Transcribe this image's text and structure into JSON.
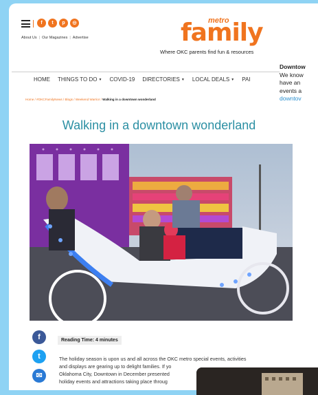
{
  "header": {
    "top_links": [
      "About Us",
      "Our Magazines",
      "Advertise"
    ],
    "social_icons": [
      "facebook-icon",
      "twitter-icon",
      "pinterest-icon",
      "instagram-icon"
    ],
    "logo": {
      "metro": "metro",
      "family": "family"
    },
    "tagline": "Where OKC parents find fun & resources"
  },
  "promo": {
    "title": "Downtow",
    "lines": [
      "We know",
      "have an",
      "events a"
    ],
    "link": "downtov"
  },
  "nav": {
    "items": [
      {
        "label": "HOME",
        "caret": false
      },
      {
        "label": "THINGS TO DO",
        "caret": true
      },
      {
        "label": "COVID-19",
        "caret": false
      },
      {
        "label": "DIRECTORIES",
        "caret": true
      },
      {
        "label": "LOCAL DEALS",
        "caret": true
      },
      {
        "label": "PAI",
        "caret": false
      }
    ]
  },
  "breadcrumb": {
    "items": [
      "Home",
      "#OKCFamilyNews",
      "Blogs",
      "Weekend Warrior"
    ],
    "current": "Walking in a downtown wonderland",
    "separator": " / "
  },
  "article": {
    "title": "Walking in a downtown wonderland",
    "reading_time": "Reading Time: 4 minutes",
    "body": [
      "The holiday season is upon us and all across the OKC metro special events, activities",
      "and displays are gearing up to delight families. If yo",
      "Oklahoma City, Downtown in December presented",
      "holiday events and attractions taking place throug"
    ]
  },
  "share": [
    {
      "name": "facebook-icon",
      "glyph": "f",
      "color": "#3b5998"
    },
    {
      "name": "twitter-icon",
      "glyph": "t",
      "color": "#1da1f2"
    },
    {
      "name": "email-icon",
      "glyph": "✉",
      "color": "#2a7ad5"
    }
  ],
  "colors": {
    "accent": "#f0741f",
    "title": "#2b8fa3",
    "background": "#8fd3f4"
  }
}
